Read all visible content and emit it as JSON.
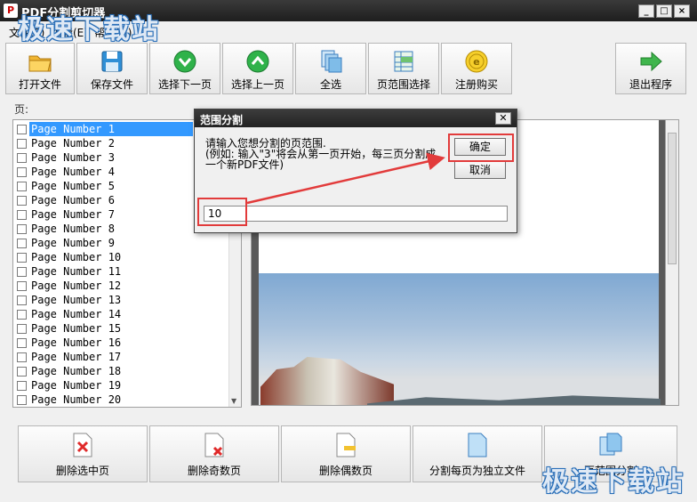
{
  "window": {
    "title": "PDF分割剪切器",
    "icon": "pdf-app-icon"
  },
  "watermark": {
    "text": "极速下载站"
  },
  "menu": [
    "文件(F)",
    "编辑(E)",
    "帮助(H)"
  ],
  "toolbar": [
    {
      "label": "打开文件",
      "icon": "folder-open-icon"
    },
    {
      "label": "保存文件",
      "icon": "floppy-disk-icon"
    },
    {
      "label": "选择下一页",
      "icon": "green-down-arrow-icon"
    },
    {
      "label": "选择上一页",
      "icon": "green-up-arrow-icon"
    },
    {
      "label": "全选",
      "icon": "select-all-pages-icon"
    },
    {
      "label": "页范围选择",
      "icon": "page-range-grid-icon"
    },
    {
      "label": "注册购买",
      "icon": "gold-coin-icon"
    },
    {
      "label": "退出程序",
      "icon": "exit-arrow-icon"
    }
  ],
  "pages_label": "页:",
  "pages": [
    "Page Number 1",
    "Page Number 2",
    "Page Number 3",
    "Page Number 4",
    "Page Number 5",
    "Page Number 6",
    "Page Number 7",
    "Page Number 8",
    "Page Number 9",
    "Page Number 10",
    "Page Number 11",
    "Page Number 12",
    "Page Number 13",
    "Page Number 14",
    "Page Number 15",
    "Page Number 16",
    "Page Number 17",
    "Page Number 18",
    "Page Number 19",
    "Page Number 20"
  ],
  "selected_page_index": 0,
  "bottom_buttons": [
    {
      "label": "删除选中页",
      "icon": "delete-page-icon"
    },
    {
      "label": "删除奇数页",
      "icon": "delete-odd-pages-icon"
    },
    {
      "label": "删除偶数页",
      "icon": "delete-even-pages-icon"
    },
    {
      "label": "分割每页为独立文件",
      "icon": "split-pages-icon"
    },
    {
      "label": "页范围分割",
      "icon": "range-split-icon"
    }
  ],
  "dialog": {
    "title": "范围分割",
    "prompt_line1": "请输入您想分割的页范围.",
    "prompt_line2": "(例如: 输入\"3\"将会从第一页开始，每三页分割成",
    "prompt_line3": "一个新PDF文件)",
    "ok_label": "确定",
    "cancel_label": "取消",
    "input_value": "10"
  },
  "colors": {
    "highlight": "#e23b3b",
    "selection": "#3399ff"
  }
}
